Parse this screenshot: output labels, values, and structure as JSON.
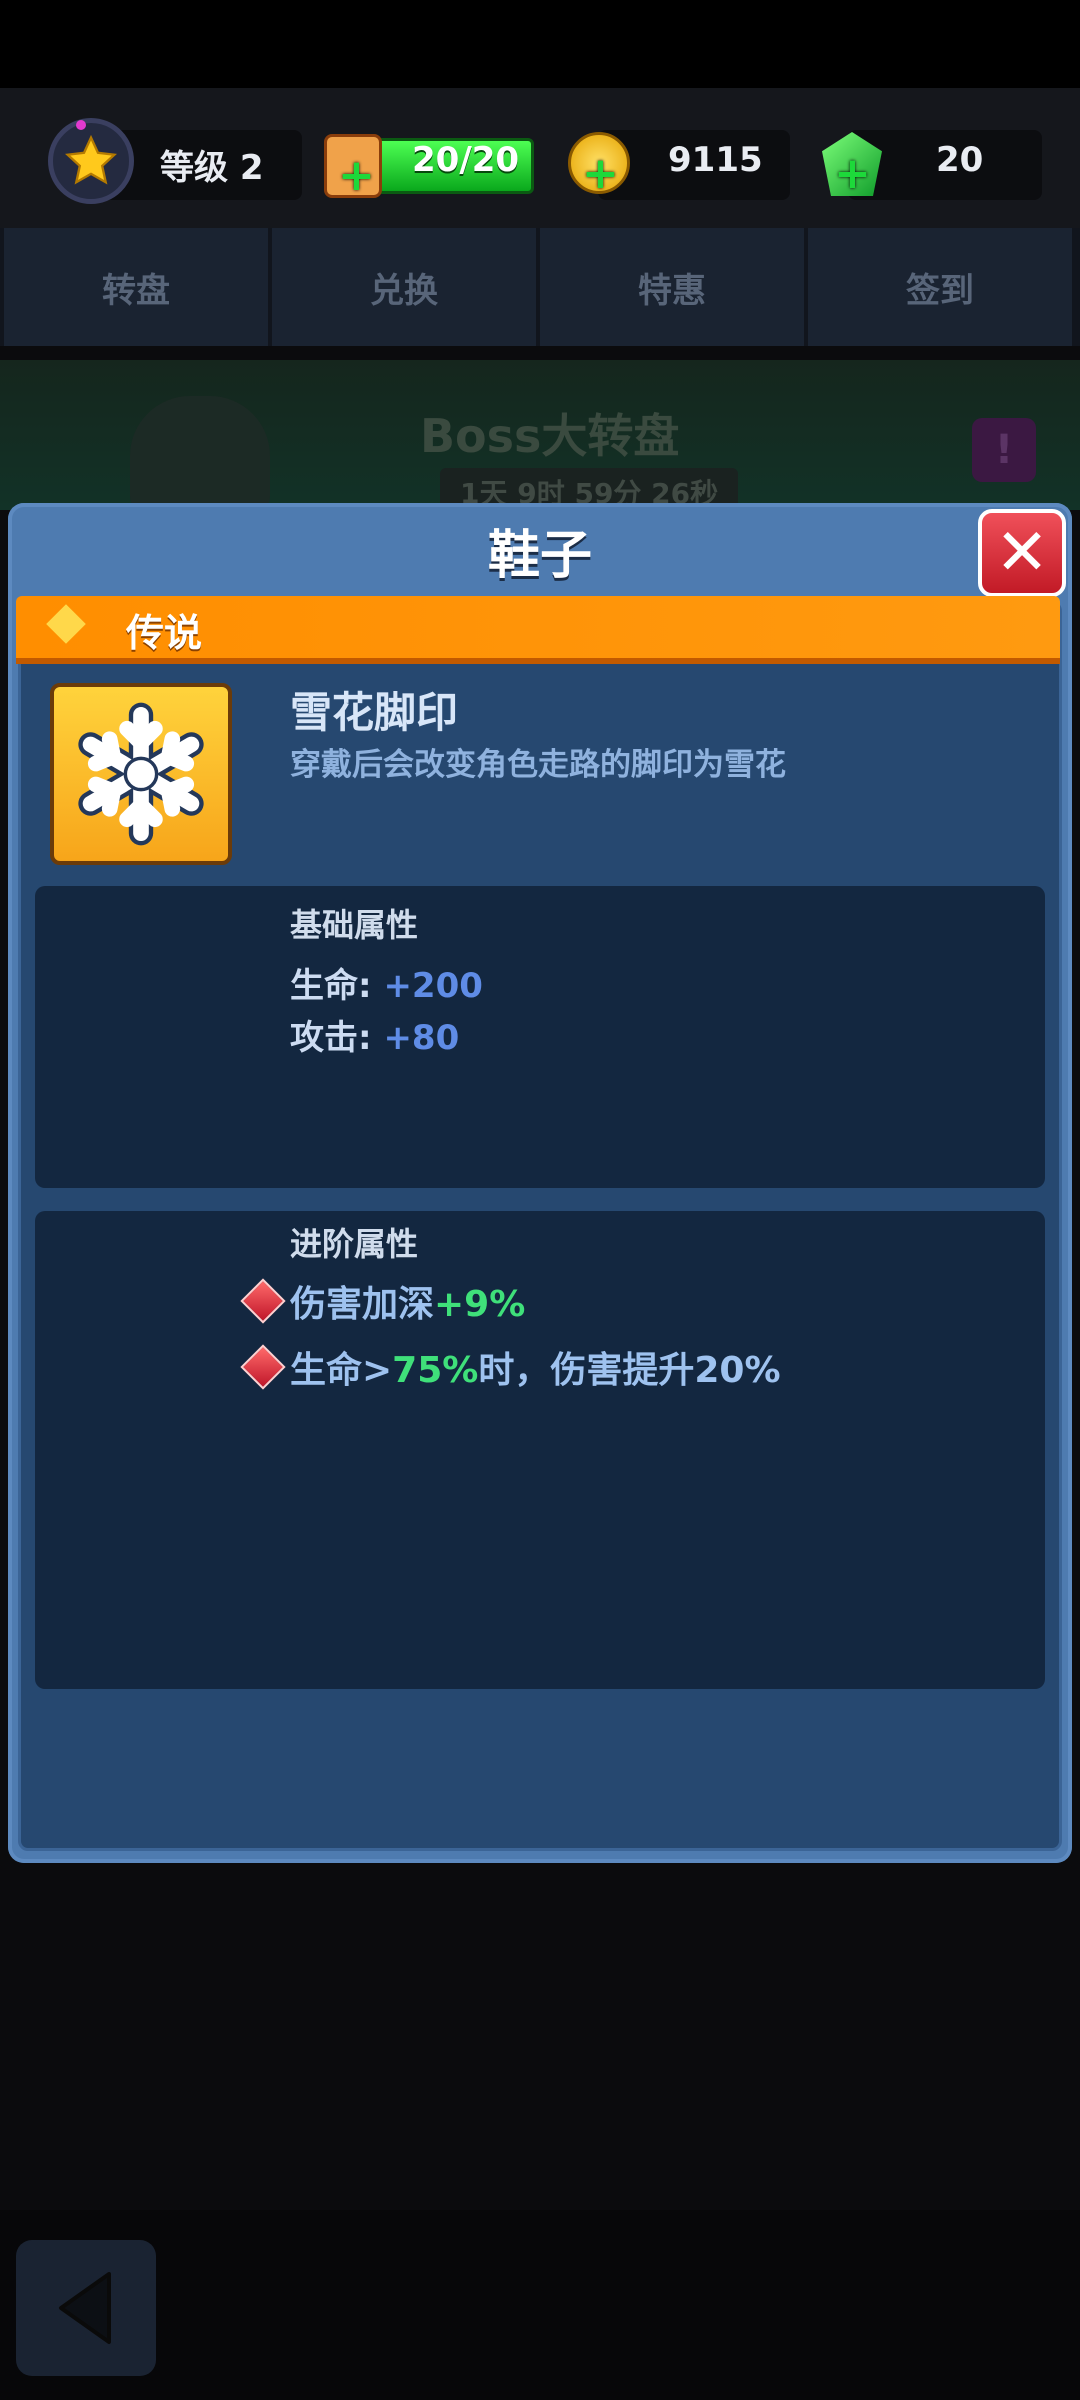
{
  "hud": {
    "level_label": "等级 2",
    "energy_value": "20/20",
    "coins_value": "9115",
    "gems_value": "20"
  },
  "tabs": [
    "转盘",
    "兑换",
    "特惠",
    "签到"
  ],
  "banner": {
    "title": "Boss大转盘",
    "timer": "1天 9时 59分 26秒",
    "alert": "!"
  },
  "dialog": {
    "title": "鞋子",
    "rarity": "传说",
    "item": {
      "name": "雪花脚印",
      "description": "穿戴后会改变角色走路的脚印为雪花"
    },
    "basic": {
      "heading": "基础属性",
      "stats": [
        {
          "label": "生命: ",
          "value": "+200"
        },
        {
          "label": "攻击: ",
          "value": "+80"
        }
      ]
    },
    "advanced": {
      "heading": "进阶属性",
      "lines": [
        {
          "pre": "伤害加深",
          "hl": "+9%",
          "post": ""
        },
        {
          "pre": "生命>",
          "hl": "75%",
          "post": "时，伤害提升20%"
        }
      ]
    }
  },
  "colors": {
    "rarity_orange": "#ff8e00",
    "dialog_blue": "#4e7bb0",
    "highlight_green": "#3fe07a",
    "stat_blue": "#5f8ce6"
  }
}
